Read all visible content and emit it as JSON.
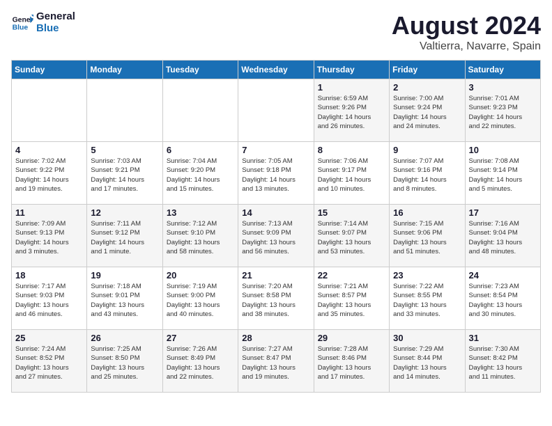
{
  "logo": {
    "line1": "General",
    "line2": "Blue"
  },
  "title": "August 2024",
  "subtitle": "Valtierra, Navarre, Spain",
  "weekdays": [
    "Sunday",
    "Monday",
    "Tuesday",
    "Wednesday",
    "Thursday",
    "Friday",
    "Saturday"
  ],
  "weeks": [
    [
      {
        "day": "",
        "info": ""
      },
      {
        "day": "",
        "info": ""
      },
      {
        "day": "",
        "info": ""
      },
      {
        "day": "",
        "info": ""
      },
      {
        "day": "1",
        "info": "Sunrise: 6:59 AM\nSunset: 9:26 PM\nDaylight: 14 hours\nand 26 minutes."
      },
      {
        "day": "2",
        "info": "Sunrise: 7:00 AM\nSunset: 9:24 PM\nDaylight: 14 hours\nand 24 minutes."
      },
      {
        "day": "3",
        "info": "Sunrise: 7:01 AM\nSunset: 9:23 PM\nDaylight: 14 hours\nand 22 minutes."
      }
    ],
    [
      {
        "day": "4",
        "info": "Sunrise: 7:02 AM\nSunset: 9:22 PM\nDaylight: 14 hours\nand 19 minutes."
      },
      {
        "day": "5",
        "info": "Sunrise: 7:03 AM\nSunset: 9:21 PM\nDaylight: 14 hours\nand 17 minutes."
      },
      {
        "day": "6",
        "info": "Sunrise: 7:04 AM\nSunset: 9:20 PM\nDaylight: 14 hours\nand 15 minutes."
      },
      {
        "day": "7",
        "info": "Sunrise: 7:05 AM\nSunset: 9:18 PM\nDaylight: 14 hours\nand 13 minutes."
      },
      {
        "day": "8",
        "info": "Sunrise: 7:06 AM\nSunset: 9:17 PM\nDaylight: 14 hours\nand 10 minutes."
      },
      {
        "day": "9",
        "info": "Sunrise: 7:07 AM\nSunset: 9:16 PM\nDaylight: 14 hours\nand 8 minutes."
      },
      {
        "day": "10",
        "info": "Sunrise: 7:08 AM\nSunset: 9:14 PM\nDaylight: 14 hours\nand 5 minutes."
      }
    ],
    [
      {
        "day": "11",
        "info": "Sunrise: 7:09 AM\nSunset: 9:13 PM\nDaylight: 14 hours\nand 3 minutes."
      },
      {
        "day": "12",
        "info": "Sunrise: 7:11 AM\nSunset: 9:12 PM\nDaylight: 14 hours\nand 1 minute."
      },
      {
        "day": "13",
        "info": "Sunrise: 7:12 AM\nSunset: 9:10 PM\nDaylight: 13 hours\nand 58 minutes."
      },
      {
        "day": "14",
        "info": "Sunrise: 7:13 AM\nSunset: 9:09 PM\nDaylight: 13 hours\nand 56 minutes."
      },
      {
        "day": "15",
        "info": "Sunrise: 7:14 AM\nSunset: 9:07 PM\nDaylight: 13 hours\nand 53 minutes."
      },
      {
        "day": "16",
        "info": "Sunrise: 7:15 AM\nSunset: 9:06 PM\nDaylight: 13 hours\nand 51 minutes."
      },
      {
        "day": "17",
        "info": "Sunrise: 7:16 AM\nSunset: 9:04 PM\nDaylight: 13 hours\nand 48 minutes."
      }
    ],
    [
      {
        "day": "18",
        "info": "Sunrise: 7:17 AM\nSunset: 9:03 PM\nDaylight: 13 hours\nand 46 minutes."
      },
      {
        "day": "19",
        "info": "Sunrise: 7:18 AM\nSunset: 9:01 PM\nDaylight: 13 hours\nand 43 minutes."
      },
      {
        "day": "20",
        "info": "Sunrise: 7:19 AM\nSunset: 9:00 PM\nDaylight: 13 hours\nand 40 minutes."
      },
      {
        "day": "21",
        "info": "Sunrise: 7:20 AM\nSunset: 8:58 PM\nDaylight: 13 hours\nand 38 minutes."
      },
      {
        "day": "22",
        "info": "Sunrise: 7:21 AM\nSunset: 8:57 PM\nDaylight: 13 hours\nand 35 minutes."
      },
      {
        "day": "23",
        "info": "Sunrise: 7:22 AM\nSunset: 8:55 PM\nDaylight: 13 hours\nand 33 minutes."
      },
      {
        "day": "24",
        "info": "Sunrise: 7:23 AM\nSunset: 8:54 PM\nDaylight: 13 hours\nand 30 minutes."
      }
    ],
    [
      {
        "day": "25",
        "info": "Sunrise: 7:24 AM\nSunset: 8:52 PM\nDaylight: 13 hours\nand 27 minutes."
      },
      {
        "day": "26",
        "info": "Sunrise: 7:25 AM\nSunset: 8:50 PM\nDaylight: 13 hours\nand 25 minutes."
      },
      {
        "day": "27",
        "info": "Sunrise: 7:26 AM\nSunset: 8:49 PM\nDaylight: 13 hours\nand 22 minutes."
      },
      {
        "day": "28",
        "info": "Sunrise: 7:27 AM\nSunset: 8:47 PM\nDaylight: 13 hours\nand 19 minutes."
      },
      {
        "day": "29",
        "info": "Sunrise: 7:28 AM\nSunset: 8:46 PM\nDaylight: 13 hours\nand 17 minutes."
      },
      {
        "day": "30",
        "info": "Sunrise: 7:29 AM\nSunset: 8:44 PM\nDaylight: 13 hours\nand 14 minutes."
      },
      {
        "day": "31",
        "info": "Sunrise: 7:30 AM\nSunset: 8:42 PM\nDaylight: 13 hours\nand 11 minutes."
      }
    ]
  ]
}
